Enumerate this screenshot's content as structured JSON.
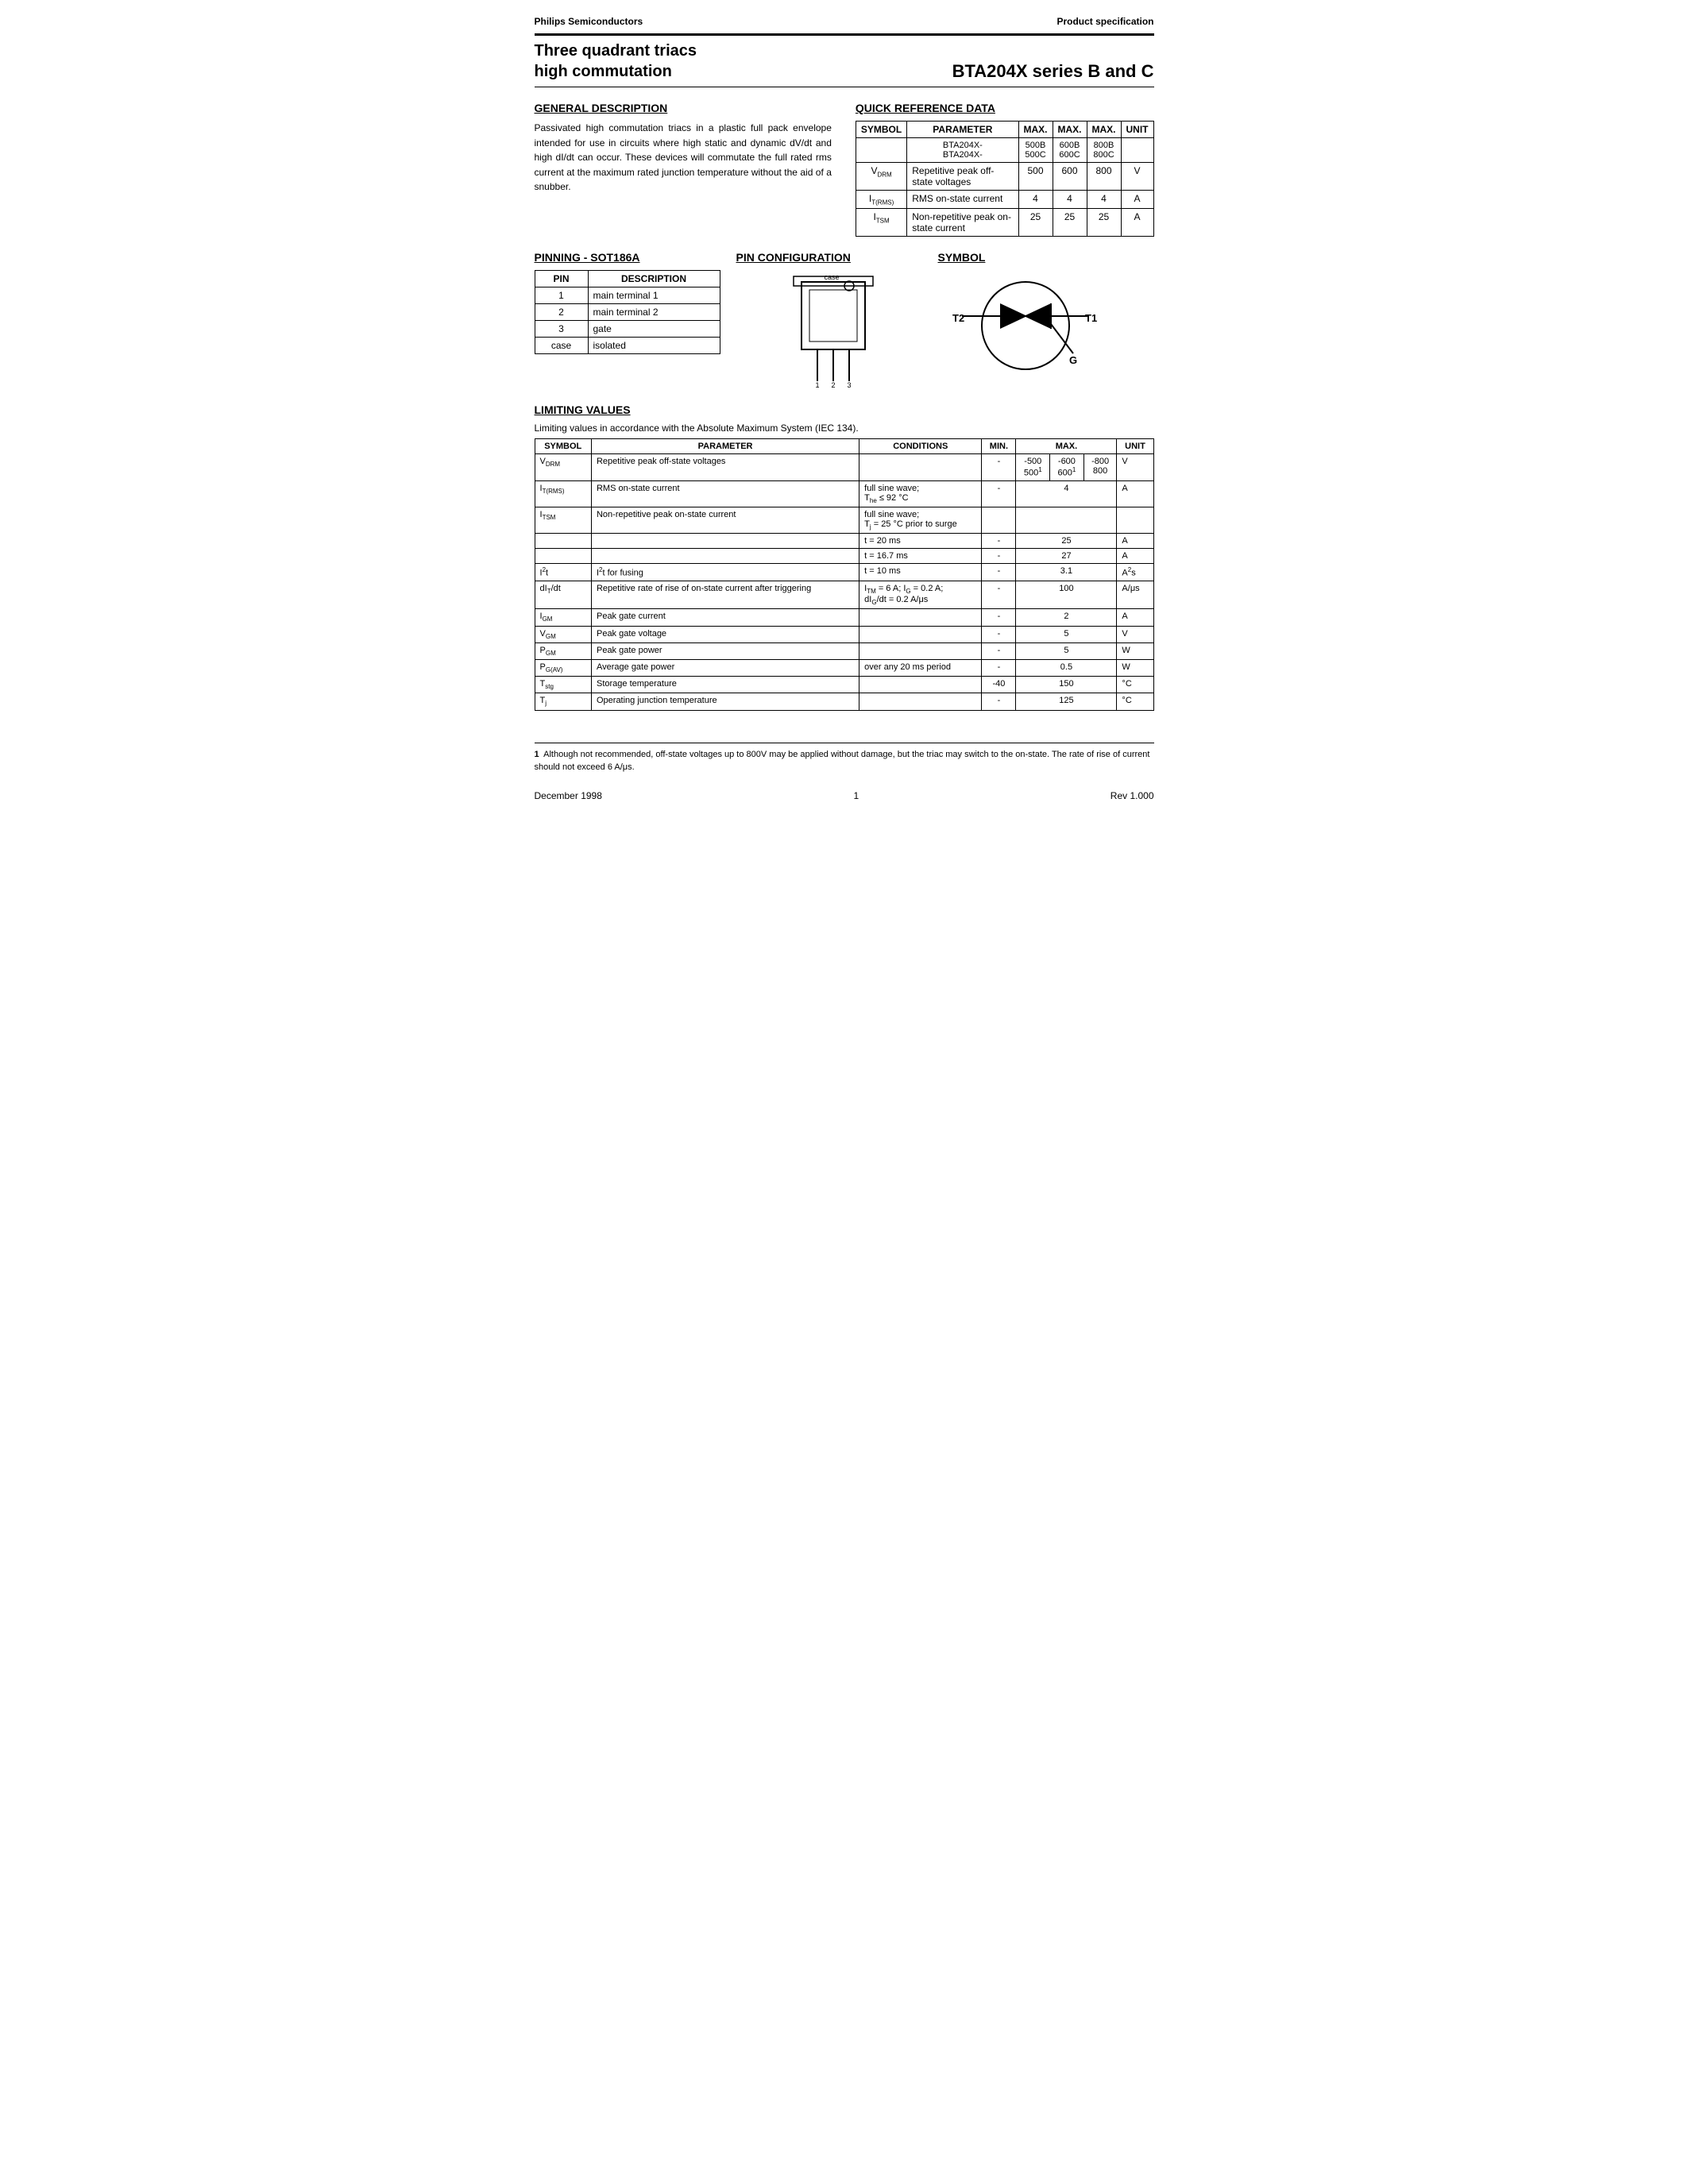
{
  "header": {
    "company": "Philips Semiconductors",
    "doc_type": "Product specification"
  },
  "title": {
    "left_line1": "Three quadrant triacs",
    "left_line2": "high commutation",
    "right": "BTA204X series  B and C"
  },
  "general_description": {
    "heading": "GENERAL DESCRIPTION",
    "text": "Passivated high commutation triacs in a plastic full pack envelope intended for use in circuits where high static and dynamic dV/dt and high dI/dt can occur. These devices will commutate the full rated rms current at the maximum rated junction temperature without the aid of a snubber."
  },
  "quick_reference": {
    "heading": "QUICK REFERENCE DATA",
    "columns": [
      "SYMBOL",
      "PARAMETER",
      "MAX.",
      "MAX.",
      "MAX.",
      "UNIT"
    ],
    "subheader": [
      "",
      "BTA204X-\nBTA204X-",
      "500B\n500C",
      "600B\n600C",
      "800B\n800C",
      ""
    ],
    "rows": [
      {
        "symbol": "V_DRM",
        "parameter": "Repetitive peak off-state voltages",
        "max1": "500",
        "max2": "600",
        "max3": "800",
        "unit": "V"
      },
      {
        "symbol": "I_T(RMS)",
        "parameter": "RMS on-state current",
        "max1": "4",
        "max2": "4",
        "max3": "4",
        "unit": "A"
      },
      {
        "symbol": "I_TSM",
        "parameter": "Non-repetitive peak on-state current",
        "max1": "25",
        "max2": "25",
        "max3": "25",
        "unit": "A"
      }
    ]
  },
  "pinning": {
    "heading": "PINNING - SOT186A",
    "col_pin": "PIN",
    "col_desc": "DESCRIPTION",
    "rows": [
      {
        "pin": "1",
        "desc": "main terminal 1"
      },
      {
        "pin": "2",
        "desc": "main terminal 2"
      },
      {
        "pin": "3",
        "desc": "gate"
      },
      {
        "pin": "case",
        "desc": "isolated"
      }
    ]
  },
  "pin_config": {
    "heading": "PIN CONFIGURATION"
  },
  "symbol_section": {
    "heading": "SYMBOL",
    "t2_label": "T2",
    "t1_label": "T1",
    "g_label": "G"
  },
  "limiting_values": {
    "heading": "LIMITING VALUES",
    "intro": "Limiting values in accordance with the Absolute Maximum System (IEC 134).",
    "columns": [
      "SYMBOL",
      "PARAMETER",
      "CONDITIONS",
      "MIN.",
      "MAX.",
      "UNIT"
    ],
    "rows": [
      {
        "symbol": "V_DRM",
        "parameter": "Repetitive peak off-state voltages",
        "conditions": "",
        "min": "-",
        "max_a": "-500\n500¹",
        "max_b": "-600\n600¹",
        "max_c": "-800\n800",
        "unit": "V"
      },
      {
        "symbol": "I_T(RMS)",
        "parameter": "RMS on-state current",
        "conditions": "full sine wave;\nThe ≤ 92 °C",
        "min": "-",
        "max": "4",
        "unit": "A"
      },
      {
        "symbol": "I_TSM",
        "parameter": "Non-repetitive peak on-state current",
        "conditions": "full sine wave;\nTj = 25 °C prior to surge",
        "min": "",
        "max": "",
        "unit": ""
      },
      {
        "symbol": "",
        "parameter": "",
        "conditions": "t = 20 ms",
        "min": "-",
        "max": "25",
        "unit": "A"
      },
      {
        "symbol": "",
        "parameter": "",
        "conditions": "t = 16.7 ms",
        "min": "-",
        "max": "27",
        "unit": "A"
      },
      {
        "symbol": "I²t",
        "parameter": "I²t for fusing",
        "conditions": "t = 10 ms",
        "min": "-",
        "max": "3.1",
        "unit": "A²s"
      },
      {
        "symbol": "dIT/dt",
        "parameter": "Repetitive rate of rise of on-state current after triggering",
        "conditions": "ITM = 6 A; IG = 0.2 A;\ndIG/dt = 0.2 A/μs",
        "min": "-",
        "max": "100",
        "unit": "A/μs"
      },
      {
        "symbol": "IGM",
        "parameter": "Peak gate current",
        "conditions": "",
        "min": "-",
        "max": "2",
        "unit": "A"
      },
      {
        "symbol": "VGM",
        "parameter": "Peak gate voltage",
        "conditions": "",
        "min": "-",
        "max": "5",
        "unit": "V"
      },
      {
        "symbol": "PGM",
        "parameter": "Peak gate power",
        "conditions": "",
        "min": "-",
        "max": "5",
        "unit": "W"
      },
      {
        "symbol": "PG(AV)",
        "parameter": "Average gate power",
        "conditions": "over any 20 ms period",
        "min": "-",
        "max": "0.5",
        "unit": "W"
      },
      {
        "symbol": "Tstg",
        "parameter": "Storage temperature",
        "conditions": "",
        "min": "-40",
        "max": "150",
        "unit": "°C"
      },
      {
        "symbol": "Tj",
        "parameter": "Operating junction temperature",
        "conditions": "",
        "min": "-",
        "max": "125",
        "unit": "°C"
      }
    ]
  },
  "footer": {
    "note_num": "1",
    "note_text": "Although not recommended, off-state voltages up to 800V may be applied without damage, but the triac may switch to the on-state. The rate of rise of current should not exceed 6 A/μs.",
    "date": "December 1998",
    "page": "1",
    "rev": "Rev 1.000"
  }
}
